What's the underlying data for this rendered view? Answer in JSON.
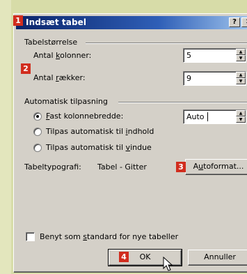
{
  "dialog": {
    "title": "Indsæt tabel",
    "help_glyph": "?",
    "close_glyph": "✕"
  },
  "callouts": [
    "1",
    "2",
    "3",
    "4"
  ],
  "size_group": {
    "label": "Tabelstørrelse",
    "columns": {
      "label_pre": "Antal ",
      "label_u": "k",
      "label_post": "olonner:",
      "value": "5"
    },
    "rows": {
      "label_pre": "Antal ",
      "label_u": "r",
      "label_post": "ækker:",
      "value": "9"
    }
  },
  "autofit_group": {
    "label": "Automatisk tilpasning",
    "options": [
      {
        "pre": "",
        "u": "F",
        "post": "ast kolonnebredde:",
        "selected": true
      },
      {
        "pre": "Tilpas automatisk til ",
        "u": "i",
        "post": "ndhold",
        "selected": false
      },
      {
        "pre": "Tilpas automatisk til ",
        "u": "v",
        "post": "indue",
        "selected": false
      }
    ],
    "fixed_width_value": "Auto"
  },
  "table_style": {
    "label": "Tabeltypografi:",
    "value": "Tabel - Gitter",
    "autoformat_pre": "A",
    "autoformat_u": "u",
    "autoformat_post": "toformat..."
  },
  "default_checkbox": {
    "pre": "Benyt som ",
    "u": "s",
    "post": "tandard for nye tabeller",
    "checked": false
  },
  "buttons": {
    "ok": "OK",
    "cancel": "Annuller"
  },
  "spin_arrows": {
    "up": "▲",
    "down": "▼"
  },
  "colors": {
    "callout": "#d12d1e",
    "titlebar": "#0a246a",
    "dialog_face": "#d4d0c8",
    "background": "#d7dca8"
  }
}
